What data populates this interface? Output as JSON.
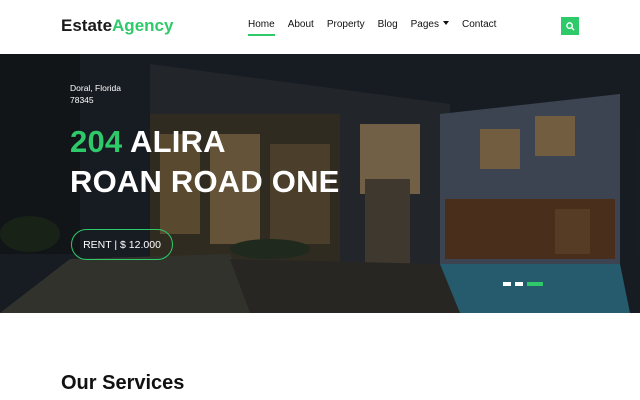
{
  "brand": {
    "name_part1": "Estate",
    "name_part2": "Agency"
  },
  "nav": {
    "items": [
      {
        "label": "Home",
        "active": true
      },
      {
        "label": "About"
      },
      {
        "label": "Property"
      },
      {
        "label": "Blog"
      },
      {
        "label": "Pages",
        "dropdown": true
      },
      {
        "label": "Contact"
      }
    ]
  },
  "search": {
    "icon": "search-icon"
  },
  "hero": {
    "location_line1": "Doral, Florida",
    "location_line2": "78345",
    "title_number": "204",
    "title_rest_line1": " ALIRA",
    "title_line2": "ROAN ROAD ONE",
    "price_button": "RENT | $ 12.000",
    "carousel": {
      "slides": 3,
      "active_index": 2
    }
  },
  "services": {
    "title": "Our Services"
  },
  "colors": {
    "accent": "#2eca6a",
    "text_dark": "#111111"
  }
}
